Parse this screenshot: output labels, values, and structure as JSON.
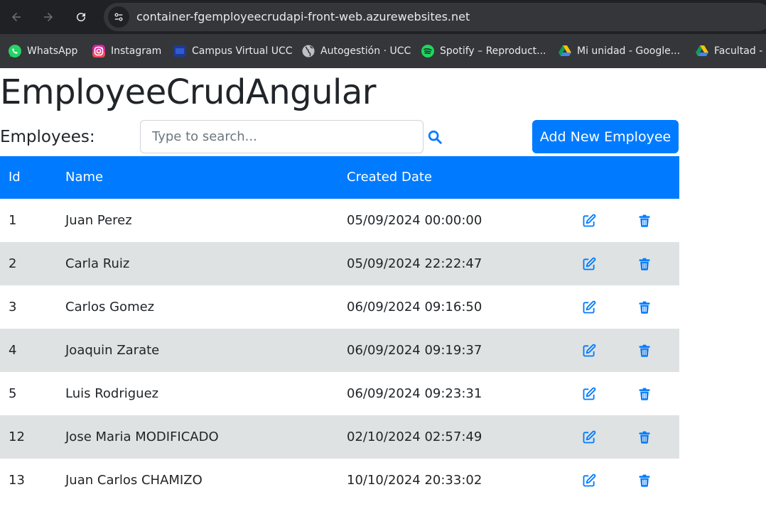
{
  "browser": {
    "url": "container-fgemployeecrudapi-front-web.azurewebsites.net",
    "bookmarks": [
      {
        "label": "WhatsApp",
        "icon": "whatsapp-icon"
      },
      {
        "label": "Instagram",
        "icon": "instagram-icon"
      },
      {
        "label": "Campus Virtual UCC",
        "icon": "campus-icon"
      },
      {
        "label": "Autogestión · UCC",
        "icon": "globe-icon"
      },
      {
        "label": "Spotify – Reproduct...",
        "icon": "spotify-icon"
      },
      {
        "label": "Mi unidad - Google...",
        "icon": "google-drive-icon"
      },
      {
        "label": "Facultad - G",
        "icon": "google-drive-icon"
      }
    ]
  },
  "page": {
    "title": "EmployeeCrudAngular",
    "employees_label": "Employees:",
    "search_placeholder": "Type to search...",
    "search_value": "",
    "add_button": "Add New Employee"
  },
  "table": {
    "headers": {
      "id": "Id",
      "name": "Name",
      "created": "Created Date"
    },
    "rows": [
      {
        "id": "1",
        "name": "Juan Perez",
        "created": "05/09/2024 00:00:00"
      },
      {
        "id": "2",
        "name": "Carla Ruiz",
        "created": "05/09/2024 22:22:47"
      },
      {
        "id": "3",
        "name": "Carlos Gomez",
        "created": "06/09/2024 09:16:50"
      },
      {
        "id": "4",
        "name": "Joaquin Zarate",
        "created": "06/09/2024 09:19:37"
      },
      {
        "id": "5",
        "name": "Luis Rodriguez",
        "created": "06/09/2024 09:23:31"
      },
      {
        "id": "12",
        "name": "Jose Maria MODIFICADO",
        "created": "02/10/2024 02:57:49"
      },
      {
        "id": "13",
        "name": "Juan Carlos CHAMIZO",
        "created": "10/10/2024 20:33:02"
      }
    ]
  },
  "colors": {
    "primary": "#007bff",
    "stripe": "#dee2e2",
    "chrome_dark": "#202124",
    "chrome_bar": "#35363a"
  }
}
